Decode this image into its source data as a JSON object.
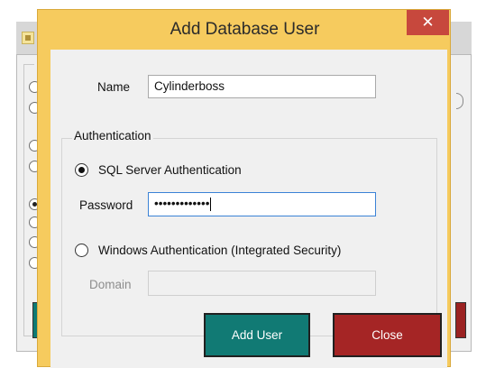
{
  "dialog": {
    "title": "Add Database User",
    "close_glyph": "✕"
  },
  "form": {
    "name_label": "Name",
    "name_value": "Cylinderboss",
    "auth_group_title": "Authentication",
    "sql_auth_label": "SQL Server Authentication",
    "sql_auth_selected": true,
    "password_label": "Password",
    "password_value": "•••••••••••••",
    "windows_auth_label": "Windows Authentication (Integrated Security)",
    "windows_auth_selected": false,
    "domain_label": "Domain",
    "domain_value": ""
  },
  "buttons": {
    "add_user": "Add User",
    "close": "Close"
  },
  "colors": {
    "dialog_frame": "#f6cb5e",
    "close_button": "#c7483d",
    "add_user_button": "#117a74",
    "close_form_button": "#a52525",
    "focus_border": "#3b82d6"
  }
}
